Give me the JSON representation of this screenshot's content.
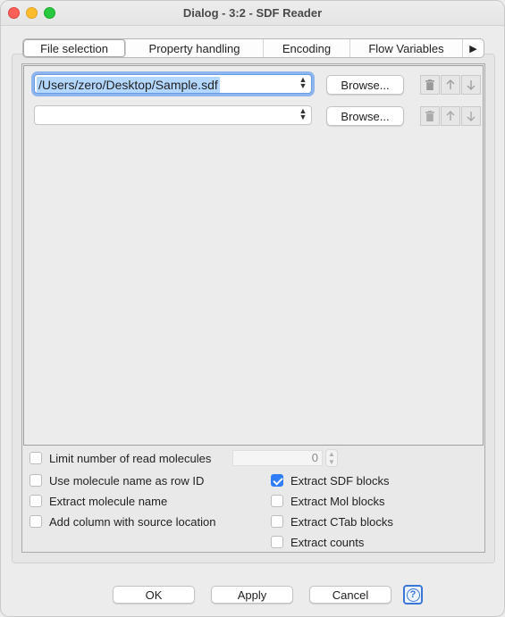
{
  "window": {
    "title": "Dialog - 3:2 - SDF Reader"
  },
  "tabs": [
    {
      "label": "File selection",
      "active": true
    },
    {
      "label": "Property handling",
      "active": false
    },
    {
      "label": "Encoding",
      "active": false
    },
    {
      "label": "Flow Variables",
      "active": false
    }
  ],
  "tab_scroll_glyph": "▶",
  "files": [
    {
      "value": "/Users/zero/Desktop/Sample.sdf",
      "browse_label": "Browse..."
    },
    {
      "value": "",
      "browse_label": "Browse..."
    }
  ],
  "options": {
    "limit_label": "Limit number of read molecules",
    "limit_checked": false,
    "limit_value": "0",
    "left": [
      {
        "label": "Use molecule name as row ID",
        "checked": false
      },
      {
        "label": "Extract molecule name",
        "checked": false
      },
      {
        "label": "Add column with source location",
        "checked": false
      }
    ],
    "right": [
      {
        "label": "Extract SDF blocks",
        "checked": true
      },
      {
        "label": "Extract Mol blocks",
        "checked": false
      },
      {
        "label": "Extract CTab blocks",
        "checked": false
      },
      {
        "label": "Extract counts",
        "checked": false
      }
    ]
  },
  "footer": {
    "ok_label": "OK",
    "apply_label": "Apply",
    "cancel_label": "Cancel",
    "help_glyph": "?"
  },
  "icons": {
    "delete": "trash-icon",
    "up": "arrow-up-icon",
    "down": "arrow-down-icon"
  },
  "colors": {
    "accent": "#2f7cf6",
    "focus_ring": "#8fb5ee",
    "selection": "#b3d7ff"
  }
}
